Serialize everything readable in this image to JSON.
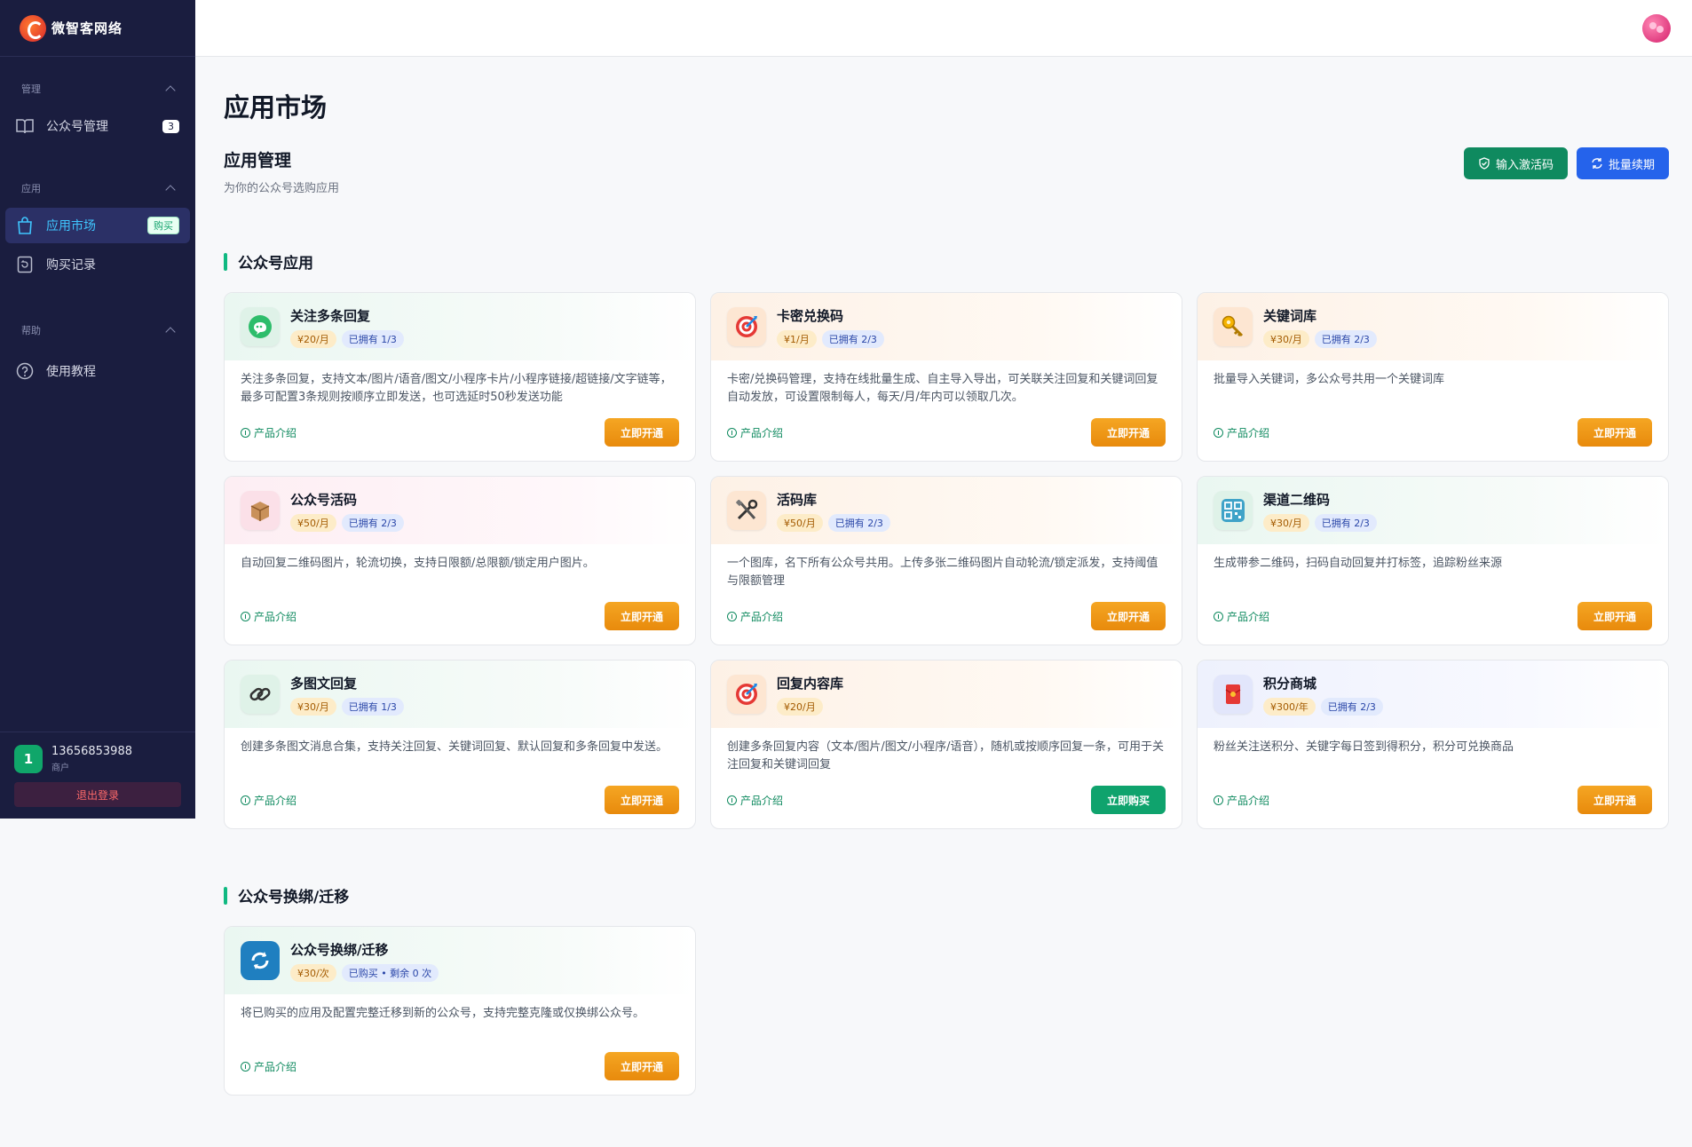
{
  "brand": {
    "name": "微智客网络"
  },
  "sidebar": {
    "groups": [
      {
        "label": "管理",
        "items": [
          {
            "label": "公众号管理",
            "badge": "3",
            "icon": "book-icon"
          }
        ]
      },
      {
        "label": "应用",
        "items": [
          {
            "label": "应用市场",
            "badge": "购买",
            "icon": "bag-icon",
            "active": true
          },
          {
            "label": "购买记录",
            "icon": "history-icon"
          }
        ]
      },
      {
        "label": "帮助",
        "items": [
          {
            "label": "使用教程",
            "icon": "help-icon"
          }
        ]
      }
    ],
    "user": {
      "initial": "1",
      "phone": "13656853988",
      "role": "商户",
      "logout": "退出登录"
    }
  },
  "page": {
    "title": "应用市场",
    "mgmt_title": "应用管理",
    "mgmt_subtitle": "为你的公众号选购应用",
    "btn_activate": "输入激活码",
    "btn_renew": "批量续期"
  },
  "sections": [
    {
      "title": "公众号应用",
      "cards": [
        {
          "name": "关注多条回复",
          "price": "¥20/月",
          "owned": "已拥有 1/3",
          "desc": "关注多条回复，支持文本/图片/语音/图文/小程序卡片/小程序链接/超链接/文字链等，最多可配置3条规则按顺序立即发送，也可选延时50秒发送功能",
          "intro": "产品介绍",
          "action": "立即开通",
          "tint": "green",
          "icon": "chat-bubble-icon"
        },
        {
          "name": "卡密兑换码",
          "price": "¥1/月",
          "owned": "已拥有 2/3",
          "desc": "卡密/兑换码管理，支持在线批量生成、自主导入导出，可关联关注回复和关键词回复自动发放，可设置限制每人，每天/月/年内可以领取几次。",
          "intro": "产品介绍",
          "action": "立即开通",
          "tint": "orange",
          "icon": "target-icon"
        },
        {
          "name": "关键词库",
          "price": "¥30/月",
          "owned": "已拥有 2/3",
          "desc": "批量导入关键词，多公众号共用一个关键词库",
          "intro": "产品介绍",
          "action": "立即开通",
          "tint": "orange",
          "icon": "key-icon"
        },
        {
          "name": "公众号活码",
          "price": "¥50/月",
          "owned": "已拥有 2/3",
          "desc": "自动回复二维码图片，轮流切换，支持日限额/总限额/锁定用户图片。",
          "intro": "产品介绍",
          "action": "立即开通",
          "tint": "pink",
          "icon": "box-icon"
        },
        {
          "name": "活码库",
          "price": "¥50/月",
          "owned": "已拥有 2/3",
          "desc": "一个图库，名下所有公众号共用。上传多张二维码图片自动轮流/锁定派发，支持阈值与限额管理",
          "intro": "产品介绍",
          "action": "立即开通",
          "tint": "orange",
          "icon": "tools-icon"
        },
        {
          "name": "渠道二维码",
          "price": "¥30/月",
          "owned": "已拥有 2/3",
          "desc": "生成带参二维码，扫码自动回复并打标签，追踪粉丝来源",
          "intro": "产品介绍",
          "action": "立即开通",
          "tint": "green",
          "icon": "qrcode-icon"
        },
        {
          "name": "多图文回复",
          "price": "¥30/月",
          "owned": "已拥有 1/3",
          "desc": "创建多条图文消息合集，支持关注回复、关键词回复、默认回复和多条回复中发送。",
          "intro": "产品介绍",
          "action": "立即开通",
          "tint": "green",
          "icon": "link-icon"
        },
        {
          "name": "回复内容库",
          "price": "¥20/月",
          "owned": "",
          "desc": "创建多条回复内容（文本/图片/图文/小程序/语音），随机或按顺序回复一条，可用于关注回复和关键词回复",
          "intro": "产品介绍",
          "action": "立即购买",
          "tint": "orange",
          "icon": "target-icon",
          "action_style": "green"
        },
        {
          "name": "积分商城",
          "price": "¥300/年",
          "owned": "已拥有 2/3",
          "desc": "粉丝关注送积分、关键字每日签到得积分，积分可兑换商品",
          "intro": "产品介绍",
          "action": "立即开通",
          "tint": "blue",
          "icon": "red-envelope-icon"
        }
      ]
    },
    {
      "title": "公众号换绑/迁移",
      "cards": [
        {
          "name": "公众号换绑/迁移",
          "price": "¥30/次",
          "owned": "已购买 • 剩余 0 次",
          "desc": "将已购买的应用及配置完整迁移到新的公众号，支持完整克隆或仅换绑公众号。",
          "intro": "产品介绍",
          "action": "立即开通",
          "tint": "green",
          "icon": "refresh-icon"
        }
      ]
    }
  ]
}
